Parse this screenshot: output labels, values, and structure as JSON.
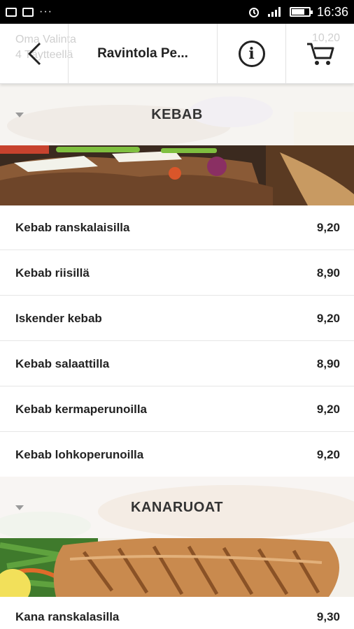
{
  "status_bar": {
    "time": "16:36",
    "overflow": "···",
    "icons": [
      "image-icon",
      "mail-icon",
      "alarm-icon",
      "signal-icon",
      "battery-icon"
    ]
  },
  "header": {
    "title": "Ravintola Pe...",
    "behind_name": "Oma Valinta",
    "behind_sub": "4 Täytteellä",
    "behind_price": "10,20",
    "info_glyph": "i"
  },
  "sections": [
    {
      "title": "KEBAB",
      "items": [
        {
          "name": "Kebab ranskalaisilla",
          "price": "9,20"
        },
        {
          "name": "Kebab riisillä",
          "price": "8,90"
        },
        {
          "name": "Iskender kebab",
          "price": "9,20"
        },
        {
          "name": "Kebab salaattilla",
          "price": "8,90"
        },
        {
          "name": "Kebab kermaperunoilla",
          "price": "9,20"
        },
        {
          "name": "Kebab lohkoperunoilla",
          "price": "9,20"
        }
      ]
    },
    {
      "title": "KANARUOAT",
      "items": [
        {
          "name": "Kana ranskalasilla",
          "price": "9,30"
        }
      ]
    }
  ],
  "colors": {
    "accent": "#222222",
    "divider": "#e6e6e6",
    "status_bar": "#000000"
  }
}
